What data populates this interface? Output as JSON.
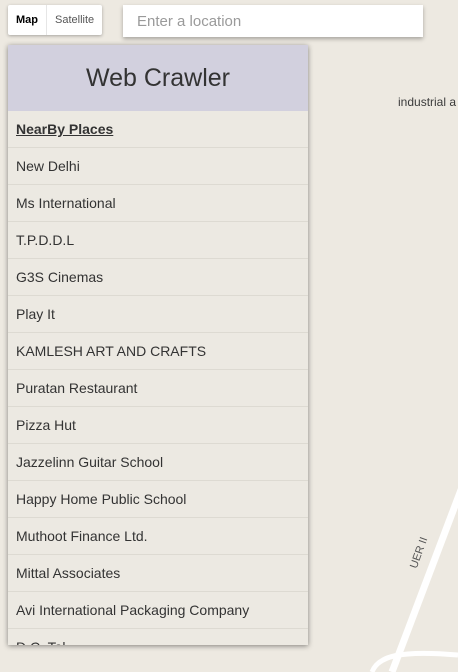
{
  "map": {
    "type_control": {
      "map_label": "Map",
      "satellite_label": "Satellite"
    },
    "labels": {
      "industrial": "industrial a",
      "road": "UER II"
    },
    "colors": {
      "background": "#ede9e1",
      "road": "#ffffff"
    }
  },
  "search": {
    "placeholder": "Enter a location",
    "value": ""
  },
  "panel": {
    "title": "Web Crawler",
    "heading": "NearBy Places",
    "colors": {
      "header_bg": "#d2d0de",
      "body_bg": "#ece9e2"
    },
    "places": [
      "New Delhi",
      "Ms International",
      "T.P.D.D.L",
      "G3S Cinemas",
      "Play It",
      "KAMLESH ART AND CRAFTS",
      "Puratan Restaurant",
      "Pizza Hut",
      "Jazzelinn Guitar School",
      "Happy Home Public School",
      "Muthoot Finance Ltd.",
      "Mittal Associates",
      "Avi International Packaging Company",
      "D.C. Tal"
    ]
  }
}
